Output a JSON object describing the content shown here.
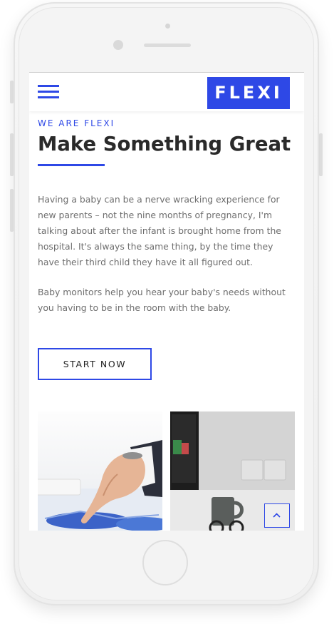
{
  "colors": {
    "accent": "#2e48e6",
    "heading": "#2a2a2a",
    "body_text": "#6e6e6e",
    "background": "#ffffff"
  },
  "header": {
    "menu_icon": "hamburger-menu-icon",
    "logo_text": "FLEXI"
  },
  "hero": {
    "eyebrow": "WE ARE FLEXI",
    "title": "Make Something Great",
    "paragraph1": "Having a baby can be a nerve wracking experience for new parents – not the nine months of pregnancy, I'm talking about after the infant is brought home from the hospital. It's always the same thing, by the time they have their third child they have it all figured out.",
    "paragraph2": "Baby monitors help you hear your baby's needs without you having to be in the room with the baby.",
    "cta_label": "START NOW"
  },
  "gallery": {
    "images": [
      "hand-pointing-at-chart-photo",
      "desk-with-monitor-and-mug-photo"
    ]
  },
  "scroll_top_icon": "chevron-up-icon"
}
